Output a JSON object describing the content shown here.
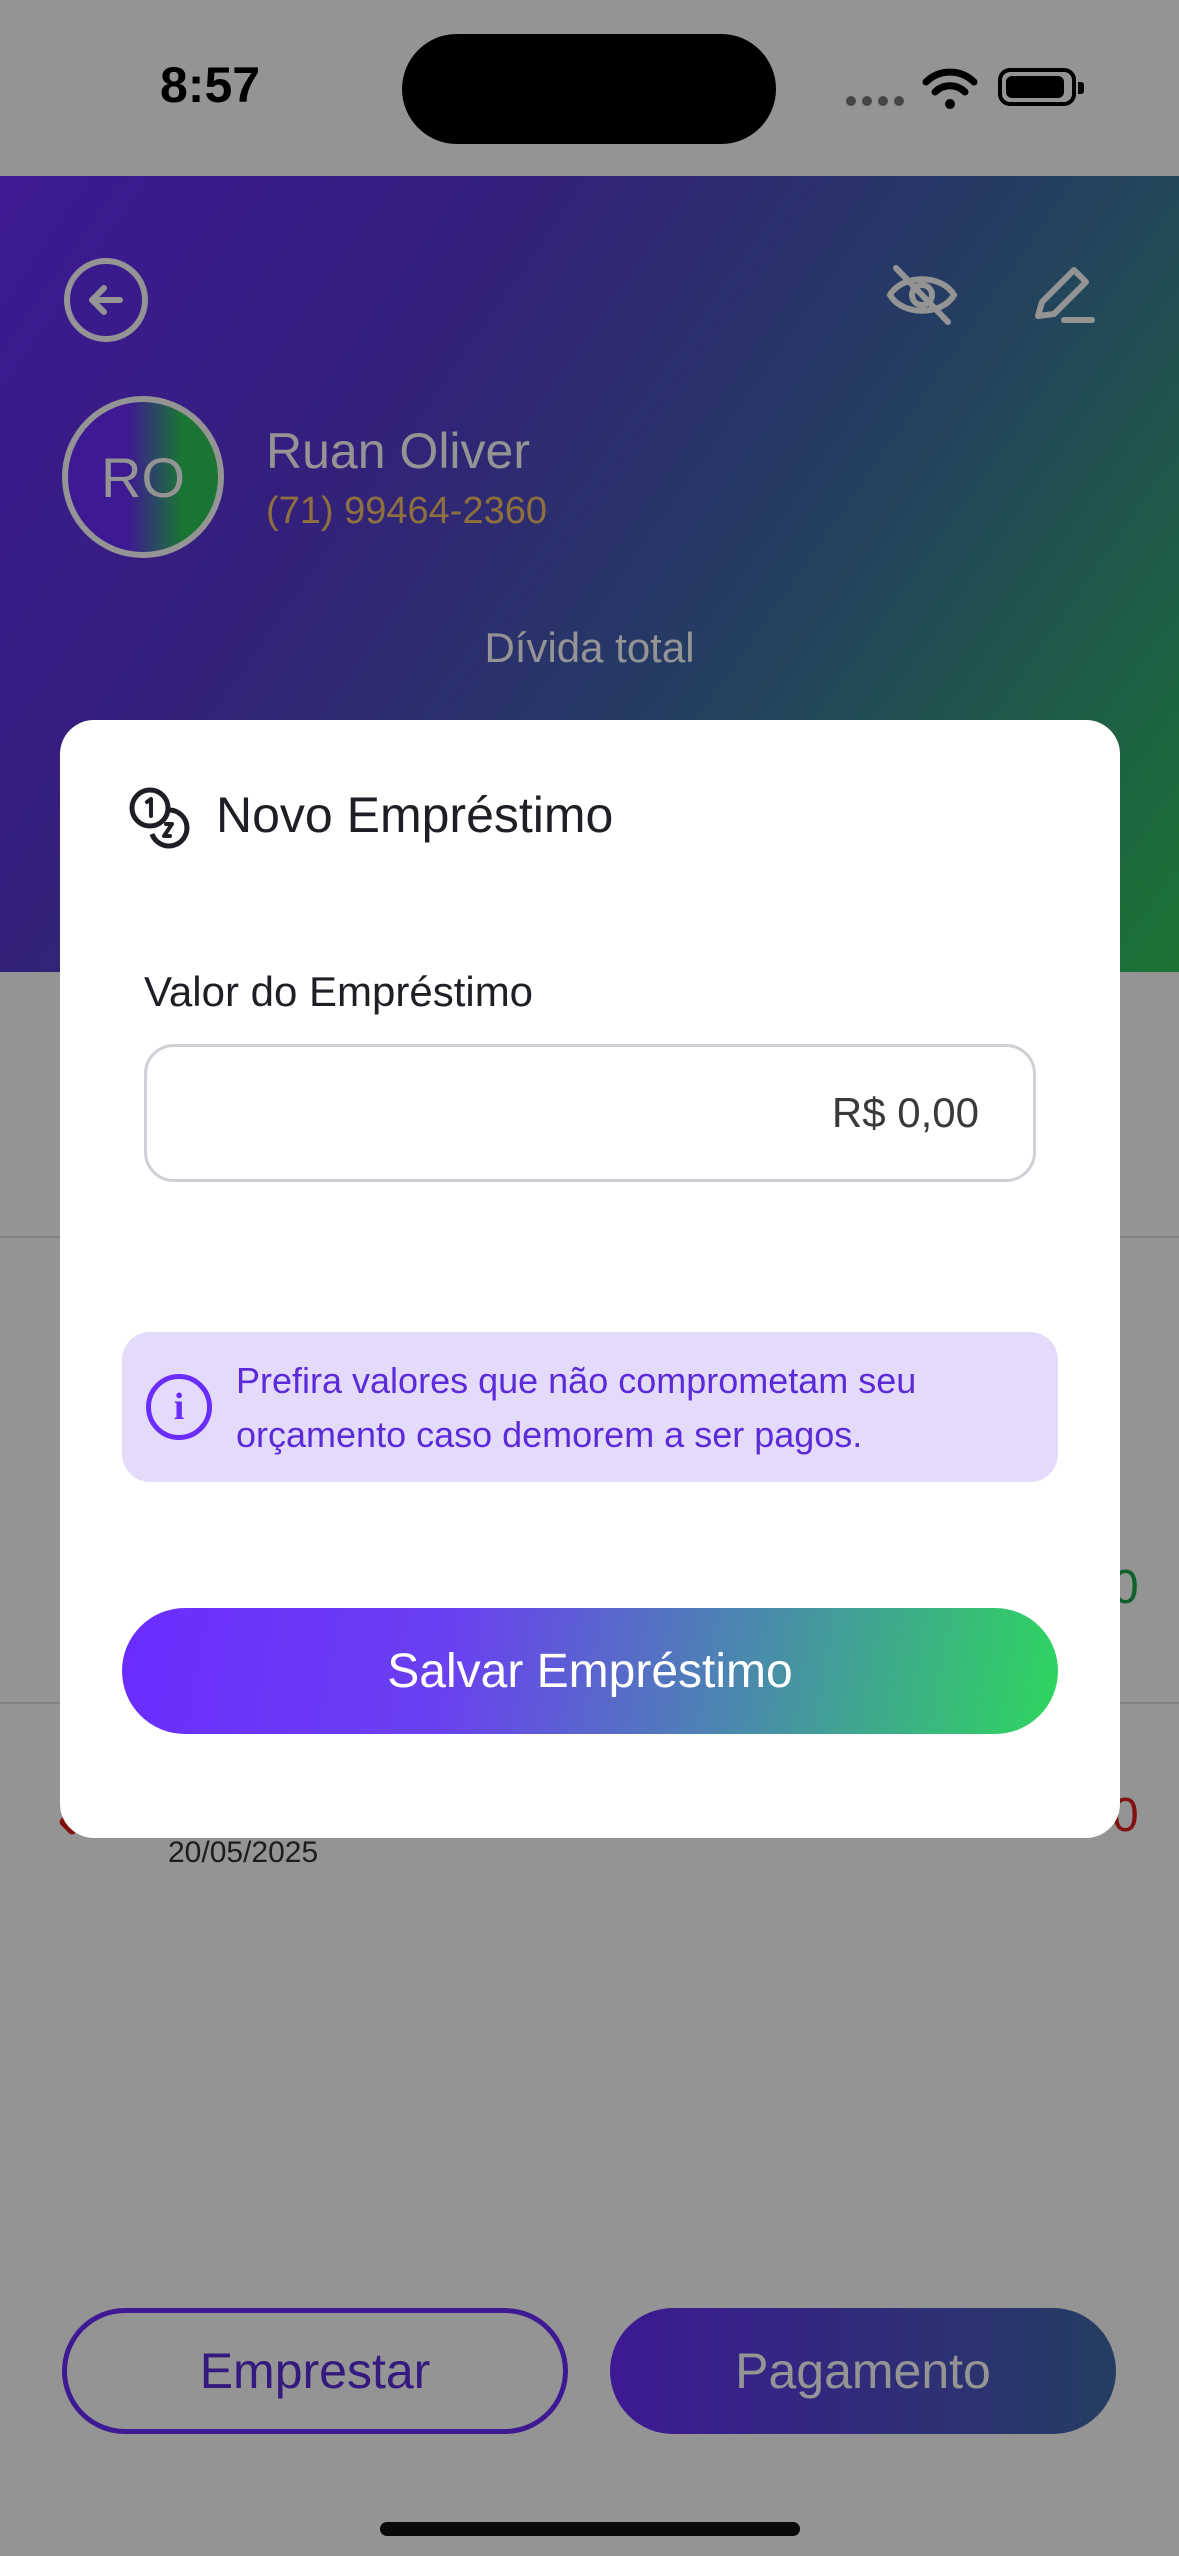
{
  "status_bar": {
    "time": "8:57"
  },
  "header": {
    "client_initials": "RO",
    "client_name": "Ruan Oliver",
    "client_phone": "(71) 99464-2360",
    "debt_label": "Dívida total"
  },
  "list": {
    "row_date": "20/05/2025"
  },
  "bottom_bar": {
    "lend_label": "Emprestar",
    "payment_label": "Pagamento"
  },
  "modal": {
    "title": "Novo Empréstimo",
    "amount_label": "Valor do Empréstimo",
    "amount_placeholder": "R$ 0,00",
    "info_text": "Prefira valores que não comprometam seu orçamento caso demorem a ser pagos.",
    "save_label": "Salvar Empréstimo"
  },
  "colors": {
    "accent_purple": "#6a2cff",
    "accent_green": "#2ec85a",
    "info_bg": "#e4dbfa"
  },
  "icons": [
    "back-arrow-icon",
    "eye-off-icon",
    "edit-pencil-icon",
    "coins-icon",
    "info-icon",
    "wifi-icon",
    "battery-icon"
  ]
}
